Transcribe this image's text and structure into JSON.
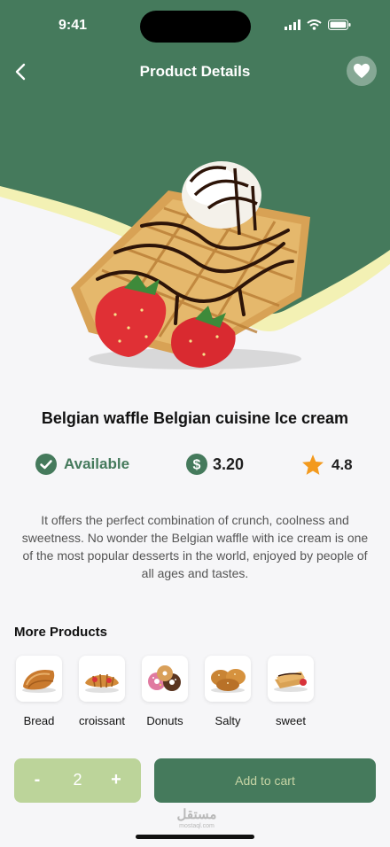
{
  "status_bar": {
    "time": "9:41"
  },
  "nav": {
    "title": "Product Details",
    "back_icon": "chevron-left-icon",
    "favorite_icon": "heart-icon"
  },
  "product": {
    "name": "Belgian waffle Belgian cuisine Ice cream",
    "availability": "Available",
    "price": "3.20",
    "rating": "4.8",
    "description": "It offers the perfect combination of crunch, coolness and sweetness. No wonder the Belgian waffle with ice cream is one of the most popular desserts in the world, enjoyed by people of all ages and tastes."
  },
  "more_products": {
    "title": "More Products",
    "items": [
      {
        "label": "Bread"
      },
      {
        "label": "croissant"
      },
      {
        "label": "Donuts"
      },
      {
        "label": "Salty"
      },
      {
        "label": "sweet"
      }
    ]
  },
  "cart": {
    "minus": "-",
    "quantity": "2",
    "plus": "+",
    "add_label": "Add to cart"
  },
  "watermark": {
    "arabic": "مستقل",
    "latin": "mostaql.com"
  },
  "colors": {
    "primary": "#457a5c",
    "accent_light": "#bcd49a",
    "yellow_band": "#f3f1b4",
    "star": "#f39a1e"
  }
}
